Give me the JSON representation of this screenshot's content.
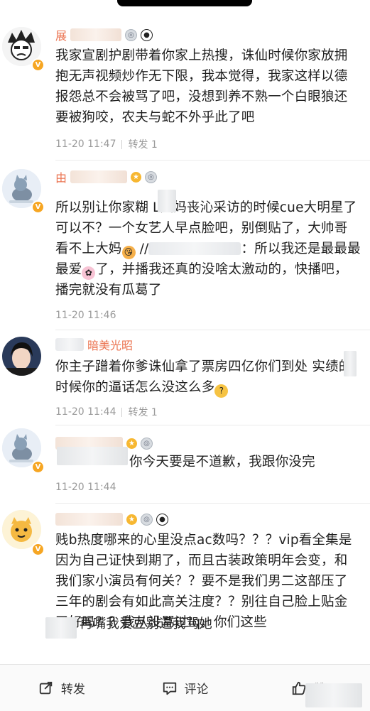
{
  "comments": [
    {
      "name_visible": "展",
      "text": "我家宣剧护剧带着你家上热搜，诛仙时候你家放拥抱无声视频炒作无下限，我本觉得，我家这样以德报怨总不会被骂了吧，没想到养不熟一个白眼狼还要被狗咬，农夫与蛇不外乎此了吧",
      "time": "11-20 11:47",
      "repost": "转发 1"
    },
    {
      "name_visible": "由",
      "text": "所以别让你家糊 L大妈丧沁采访的时候cue大明星了可以不？一个女艺人早点脸吧，别倒贴了，大帅哥看不上大妈",
      "text_tail": "//",
      "text_cont": "：所以我还是最最最最爱",
      "text_cont2": "了，并播我还真的没啥太激动的，快播吧，播完就没有瓜葛了",
      "time": "11-20 11:46",
      "repost": ""
    },
    {
      "name_visible": "暗美光昭",
      "text": "你主子蹭着你爹诛仙拿了票房四亿你们到处 实绩的时候你的逼话怎么没这么多",
      "time": "11-20 11:44",
      "repost": "转发 1"
    },
    {
      "name_visible": "",
      "text": "你今天要是不道歉，我跟你没完",
      "time": "11-20 11:44",
      "repost": ""
    },
    {
      "name_visible": "",
      "text": "贱b热度哪来的心里没点ac数吗？？？vip看全集是因为自己证快到期了，而且古装政策明年会变，和我们家小演员有何关？？要不是我们男二这部压了三年的剧会有如此高关注度？？别往自己脸上贴金了好吗？？我从没骂过lq，你们这些",
      "text_last": "再嘴我爱豆别逼我骂她",
      "time": "",
      "repost": ""
    }
  ],
  "bottom_bar": {
    "repost_label": "转发",
    "comment_label": "评论",
    "like_label": "赞"
  },
  "colors": {
    "name": "#eb7350",
    "meta": "#9a9a9a",
    "text": "#1f1f1f",
    "badge_gold": "#f7b731"
  },
  "icons": [
    "repost-icon",
    "comment-icon",
    "like-icon",
    "verified-badge-icon",
    "medal-icon",
    "panda-icon",
    "kiss-emoji-icon",
    "flower-emoji-icon",
    "thinking-emoji-icon"
  ]
}
